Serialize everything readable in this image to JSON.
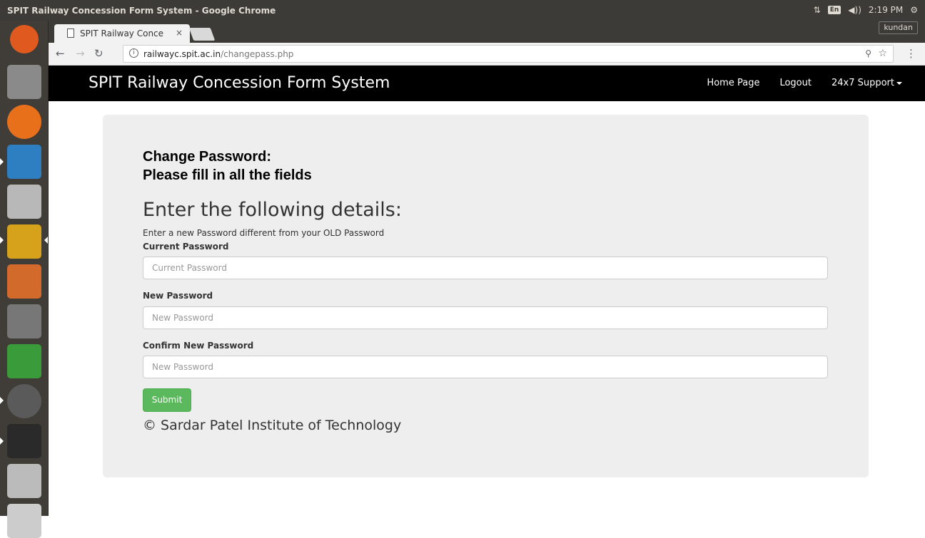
{
  "system": {
    "window_title": "SPIT Railway Concession Form System - Google Chrome",
    "keyboard": "En",
    "time": "2:19 PM",
    "user": "kundan"
  },
  "browser": {
    "tab_title": "SPIT Railway Conce",
    "tab_close": "×",
    "url_host": "railwayc.spit.ac.in",
    "url_path": "/changepass.php"
  },
  "navbar": {
    "brand": "SPIT Railway Concession Form System",
    "links": [
      "Home Page",
      "Logout",
      "24x7 Support"
    ]
  },
  "form": {
    "heading_line1": "Change Password:",
    "heading_line2": "Please fill in all the fields",
    "subheading": "Enter the following details:",
    "note": "Enter a new Password different from your OLD Password",
    "fields": [
      {
        "label": "Current Password",
        "placeholder": "Current Password"
      },
      {
        "label": "New Password",
        "placeholder": "New Password"
      },
      {
        "label": "Confirm New Password",
        "placeholder": "New Password"
      }
    ],
    "submit_label": "Submit",
    "footer": "© Sardar Patel Institute of Technology"
  },
  "colors": {
    "navbar": "#000000",
    "panel": "#eeeeee",
    "submit": "#5cb85c"
  }
}
